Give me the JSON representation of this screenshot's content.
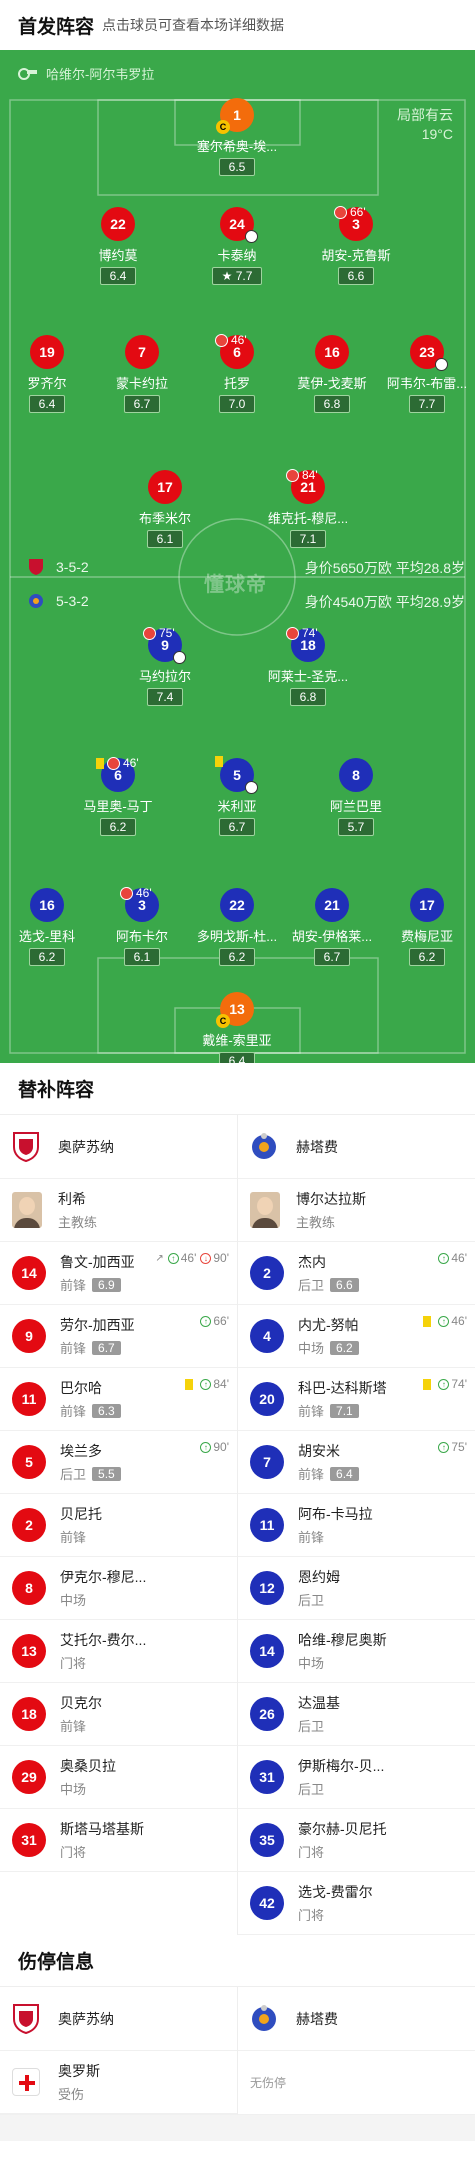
{
  "header": {
    "title": "首发阵容",
    "subtitle": "点击球员可查看本场详细数据"
  },
  "pitch": {
    "stadium": "哈维尔-阿尔韦罗拉",
    "weather": "局部有云",
    "temperature": "19°C",
    "watermark": "懂球帝",
    "home": {
      "formation": "3-5-2",
      "stat": "身价5650万欧 平均28.8岁"
    },
    "away": {
      "formation": "5-3-2",
      "stat": "身价4540万欧 平均28.9岁"
    },
    "home_players": [
      {
        "num": "1",
        "name": "塞尔希奥-埃...",
        "rating": "6.5"
      },
      {
        "num": "22",
        "name": "博约莫",
        "rating": "6.4"
      },
      {
        "num": "24",
        "name": "卡泰纳",
        "rating": "7.7"
      },
      {
        "num": "3",
        "name": "胡安-克鲁斯",
        "rating": "6.6",
        "sub": "66'"
      },
      {
        "num": "19",
        "name": "罗齐尔",
        "rating": "6.4"
      },
      {
        "num": "7",
        "name": "蒙卡约拉",
        "rating": "6.7"
      },
      {
        "num": "6",
        "name": "托罗",
        "rating": "7.0",
        "sub": "46'"
      },
      {
        "num": "16",
        "name": "莫伊-戈麦斯",
        "rating": "6.8"
      },
      {
        "num": "23",
        "name": "阿韦尔-布雷...",
        "rating": "7.7"
      },
      {
        "num": "17",
        "name": "布季米尔",
        "rating": "6.1"
      },
      {
        "num": "21",
        "name": "维克托-穆尼...",
        "rating": "7.1",
        "sub": "84'"
      }
    ],
    "away_players": [
      {
        "num": "9",
        "name": "马约拉尔",
        "rating": "7.4",
        "sub": "75'"
      },
      {
        "num": "18",
        "name": "阿莱士-圣克...",
        "rating": "6.8",
        "sub": "74'"
      },
      {
        "num": "6",
        "name": "马里奥-马丁",
        "rating": "6.2",
        "sub": "46'"
      },
      {
        "num": "5",
        "name": "米利亚",
        "rating": "6.7"
      },
      {
        "num": "8",
        "name": "阿兰巴里",
        "rating": "5.7"
      },
      {
        "num": "16",
        "name": "选戈-里科",
        "rating": "6.2"
      },
      {
        "num": "3",
        "name": "阿布卡尔",
        "rating": "6.1",
        "sub": "46'"
      },
      {
        "num": "22",
        "name": "多明戈斯-杜...",
        "rating": "6.2"
      },
      {
        "num": "21",
        "name": "胡安-伊格莱...",
        "rating": "6.7"
      },
      {
        "num": "17",
        "name": "费梅尼亚",
        "rating": "6.2"
      },
      {
        "num": "13",
        "name": "戴维-索里亚",
        "rating": "6.4"
      }
    ]
  },
  "subs": {
    "title": "替补阵容",
    "home_team": "奥萨苏纳",
    "away_team": "赫塔费",
    "home_coach": {
      "name": "利希",
      "role": "主教练"
    },
    "away_coach": {
      "name": "博尔达拉斯",
      "role": "主教练"
    },
    "home": [
      {
        "num": "14",
        "name": "鲁文-加西亚",
        "pos": "前锋",
        "rating": "6.9",
        "evt1": "46'",
        "evt2": "90'"
      },
      {
        "num": "9",
        "name": "劳尔-加西亚",
        "pos": "前锋",
        "rating": "6.7",
        "evt1": "66'"
      },
      {
        "num": "11",
        "name": "巴尔哈",
        "pos": "前锋",
        "rating": "6.3",
        "evt1": "84'"
      },
      {
        "num": "5",
        "name": "埃兰多",
        "pos": "后卫",
        "rating": "5.5",
        "evt1": "90'"
      },
      {
        "num": "2",
        "name": "贝尼托",
        "pos": "前锋"
      },
      {
        "num": "8",
        "name": "伊克尔-穆尼...",
        "pos": "中场"
      },
      {
        "num": "13",
        "name": "艾托尔-费尔...",
        "pos": "门将"
      },
      {
        "num": "18",
        "name": "贝克尔",
        "pos": "前锋"
      },
      {
        "num": "29",
        "name": "奥桑贝拉",
        "pos": "中场"
      },
      {
        "num": "31",
        "name": "斯塔马塔基斯",
        "pos": "门将"
      }
    ],
    "away": [
      {
        "num": "2",
        "name": "杰内",
        "pos": "后卫",
        "rating": "6.6",
        "evt1": "46'"
      },
      {
        "num": "4",
        "name": "内尤-努帕",
        "pos": "中场",
        "rating": "6.2",
        "evt1": "46'"
      },
      {
        "num": "20",
        "name": "科巴-达科斯塔",
        "pos": "前锋",
        "rating": "7.1",
        "evt1": "74'"
      },
      {
        "num": "7",
        "name": "胡安米",
        "pos": "前锋",
        "rating": "6.4",
        "evt1": "75'"
      },
      {
        "num": "11",
        "name": "阿布-卡马拉",
        "pos": "前锋"
      },
      {
        "num": "12",
        "name": "恩约姆",
        "pos": "后卫"
      },
      {
        "num": "14",
        "name": "哈维-穆尼奥斯",
        "pos": "中场"
      },
      {
        "num": "26",
        "name": "达温基",
        "pos": "后卫"
      },
      {
        "num": "31",
        "name": "伊斯梅尔-贝...",
        "pos": "后卫"
      },
      {
        "num": "35",
        "name": "豪尔赫-贝尼托",
        "pos": "门将"
      },
      {
        "num": "42",
        "name": "选戈-费雷尔",
        "pos": "门将"
      }
    ]
  },
  "injuries": {
    "title": "伤停信息",
    "home_team": "奥萨苏纳",
    "away_team": "赫塔费",
    "home": [
      {
        "name": "奥罗斯",
        "status": "受伤"
      }
    ],
    "away_none": "无伤停"
  },
  "colors": {
    "pitch": "#3aa84a",
    "home": "#e30a12",
    "away": "#1f2fb8",
    "keeper": "#f36c0c"
  }
}
